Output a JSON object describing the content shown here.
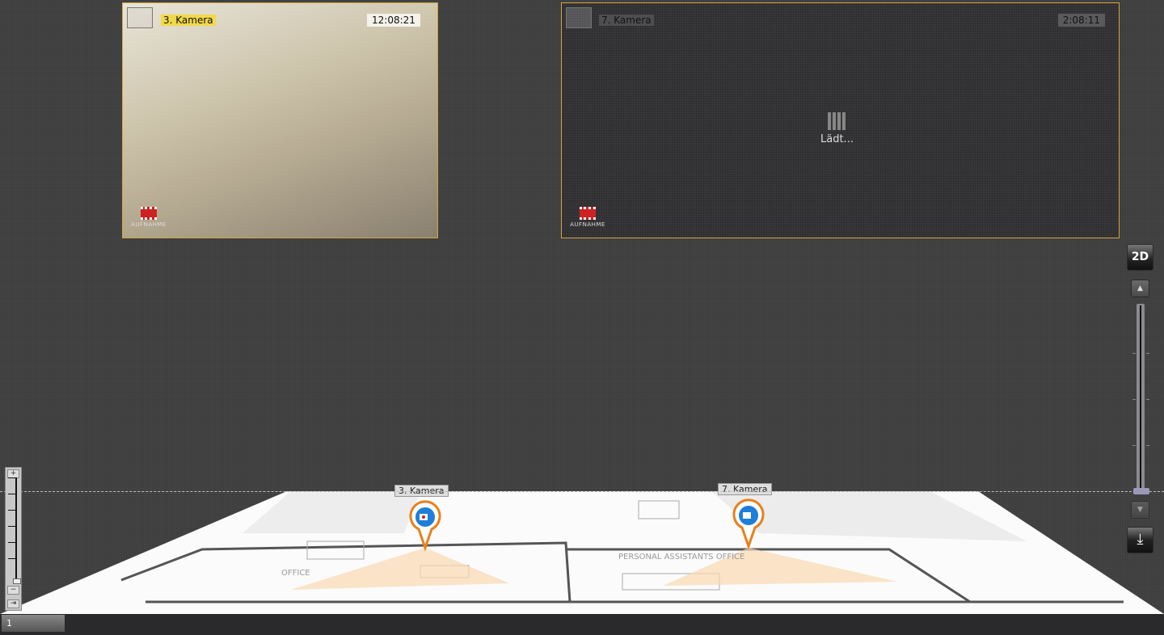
{
  "cameras": [
    {
      "name": "3. Kamera",
      "time": "12:08:21",
      "record_label": "AUFNAHME",
      "state": "live"
    },
    {
      "name": "7. Kamera",
      "time": "2:08:11",
      "record_label": "AUFNAHME",
      "status": "Lädt..."
    }
  ],
  "controls": {
    "view_mode": "2D",
    "up": "▲",
    "down": "▼",
    "download": "⤓",
    "zoom_in": "+",
    "zoom_out": "−",
    "fit": "⇥"
  },
  "map": {
    "markers": [
      {
        "label": "3. Kamera",
        "recording": true
      },
      {
        "label": "7. Kamera",
        "recording": false
      }
    ],
    "room_labels": [
      "OFFICE",
      "PERSONAL ASSISTANTS OFFICE"
    ]
  },
  "bottom": {
    "tab": "1"
  },
  "colors": {
    "tile_border": "#d4a63c",
    "marker": "#e8801e",
    "marker_icon": "#1e7fd8"
  }
}
